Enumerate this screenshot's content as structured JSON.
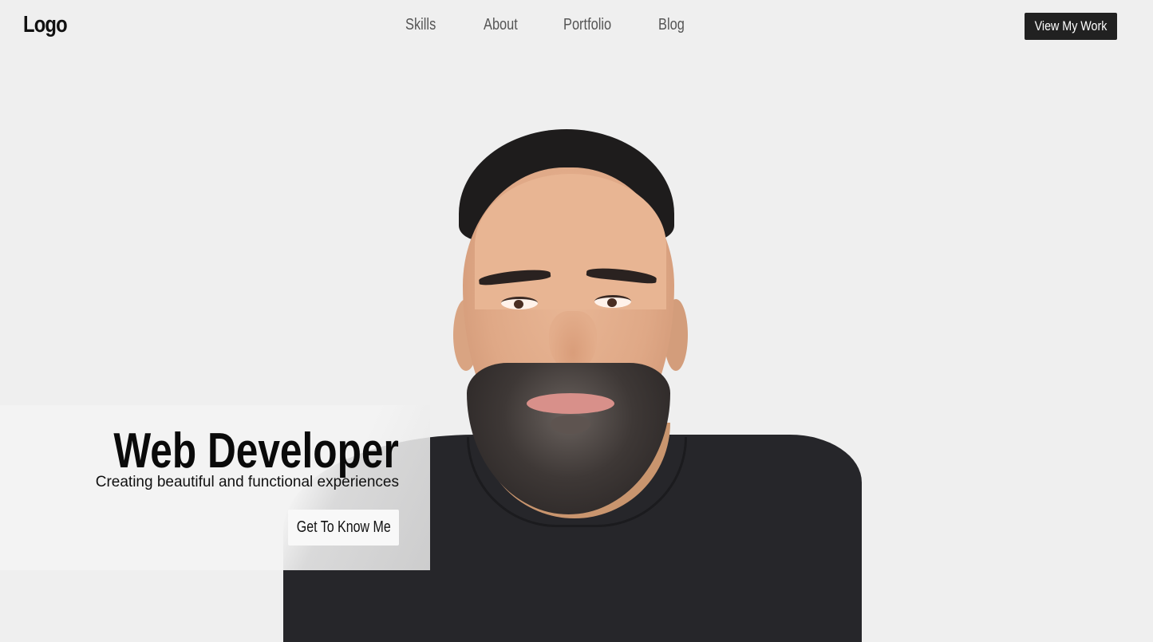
{
  "header": {
    "logo": "Logo",
    "nav": [
      {
        "label": "Skills"
      },
      {
        "label": "About"
      },
      {
        "label": "Portfolio"
      },
      {
        "label": "Blog"
      }
    ],
    "cta_label": "View My Work"
  },
  "hero": {
    "title": "Web Developer",
    "subtitle": "Creating beautiful and functional experiences",
    "button_label": "Get To Know Me",
    "image_alt": "Portrait of a smiling bearded man in a black t-shirt"
  },
  "colors": {
    "background": "#efefef",
    "cta_background": "#212121",
    "text_primary": "#0a0a0a",
    "nav_text": "#555555"
  }
}
